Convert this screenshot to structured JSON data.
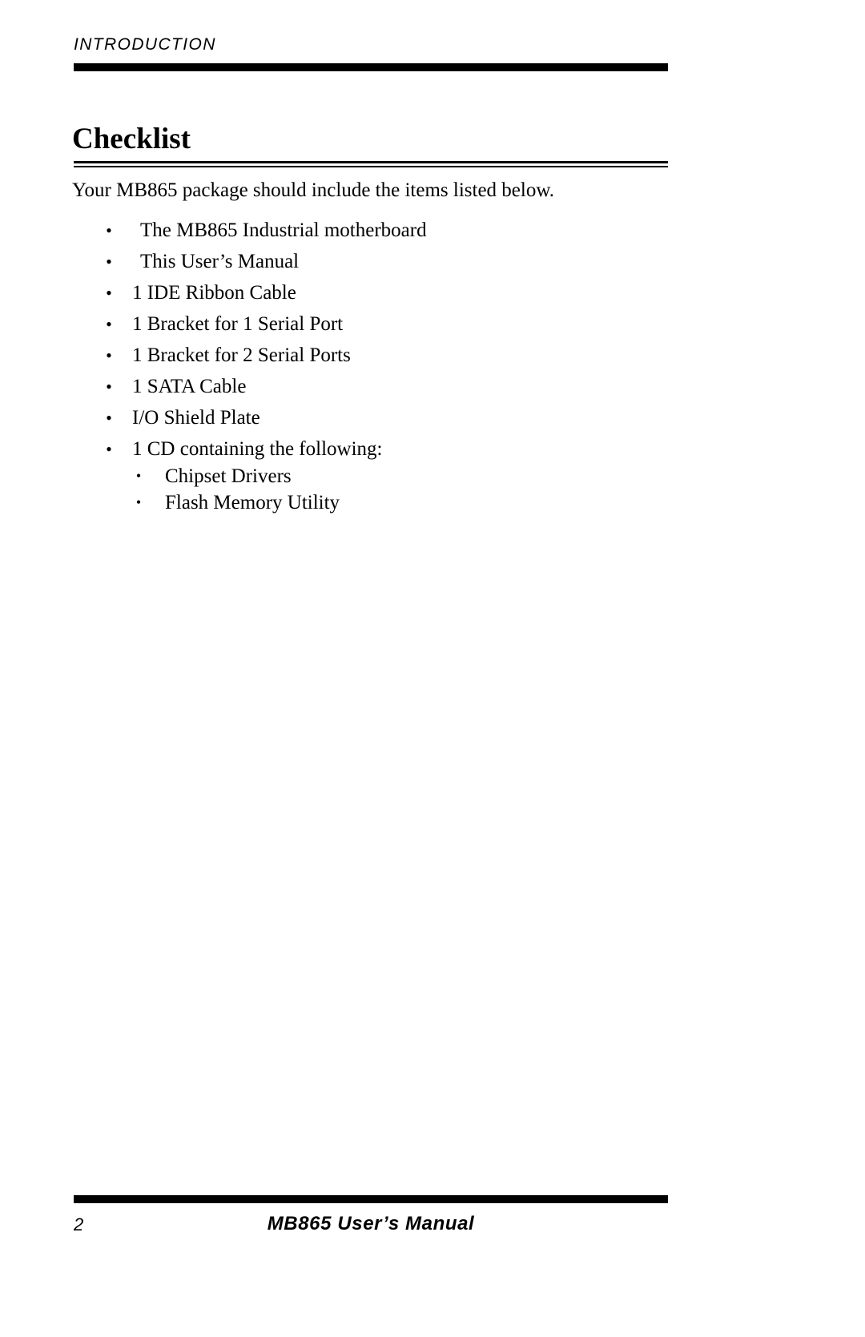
{
  "header": {
    "running_head": "INTRODUCTION"
  },
  "section": {
    "title": "Checklist",
    "intro_paragraph": "Your MB865 package should include the items listed below."
  },
  "checklist": {
    "items": [
      {
        "label": "The MB865 Industrial motherboard",
        "bullet": "•"
      },
      {
        "label": "This User’s Manual",
        "bullet": "•"
      },
      {
        "label": "1 IDE Ribbon Cable",
        "bullet": "•"
      },
      {
        "label": "1 Bracket for 1 Serial Port",
        "bullet": "•"
      },
      {
        "label": "1 Bracket for 2 Serial Ports",
        "bullet": "•"
      },
      {
        "label": "1 SATA Cable",
        "bullet": "•"
      },
      {
        "label": "I/O Shield Plate",
        "bullet": "•"
      },
      {
        "label": "1 CD containing the following:",
        "bullet": "•"
      }
    ],
    "sub_items": [
      {
        "label": "Chipset Drivers",
        "bullet": "•"
      },
      {
        "label": "Flash Memory Utility",
        "bullet": "•"
      }
    ]
  },
  "footer": {
    "page_number": "2",
    "manual_title": "MB865 User’s Manual"
  }
}
